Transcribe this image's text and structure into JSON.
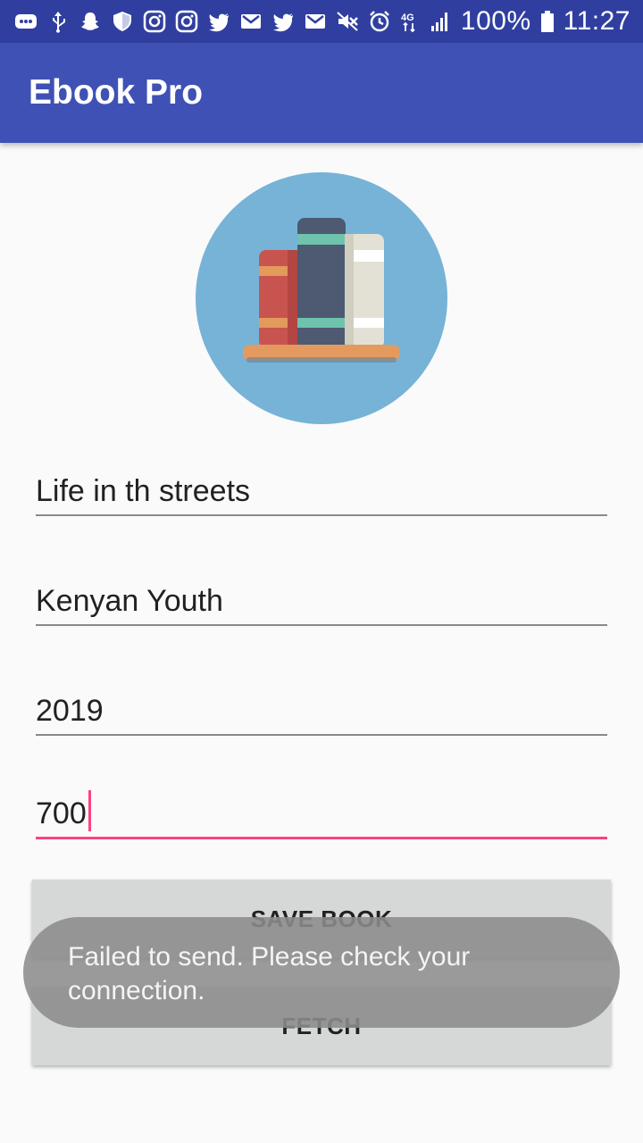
{
  "status_bar": {
    "battery": "100%",
    "time": "11:27",
    "network": "4G",
    "icons_left": [
      "message-icon",
      "usb-icon",
      "snapchat-icon",
      "shield-icon",
      "instagram-icon",
      "instagram-icon",
      "twitter-icon",
      "gmail-icon",
      "twitter-icon",
      "gmail-icon"
    ],
    "icons_right": [
      "mute-icon",
      "alarm-icon",
      "data-4g-icon",
      "signal-icon",
      "battery-icon"
    ]
  },
  "app_bar": {
    "title": "Ebook Pro"
  },
  "logo": {
    "icon": "bookshelf-icon"
  },
  "form": {
    "title": "Life in th streets",
    "author": "Kenyan Youth",
    "year": "2019",
    "pages": "700"
  },
  "buttons": {
    "save": "SAVE BOOK",
    "fetch": "FETCH"
  },
  "toast": {
    "message": "Failed to send. Please check your connection."
  },
  "colors": {
    "primary": "#3f51b5",
    "primary_dark": "#303f9f",
    "accent": "#ff4081",
    "logo_circle": "#76b3d7"
  }
}
